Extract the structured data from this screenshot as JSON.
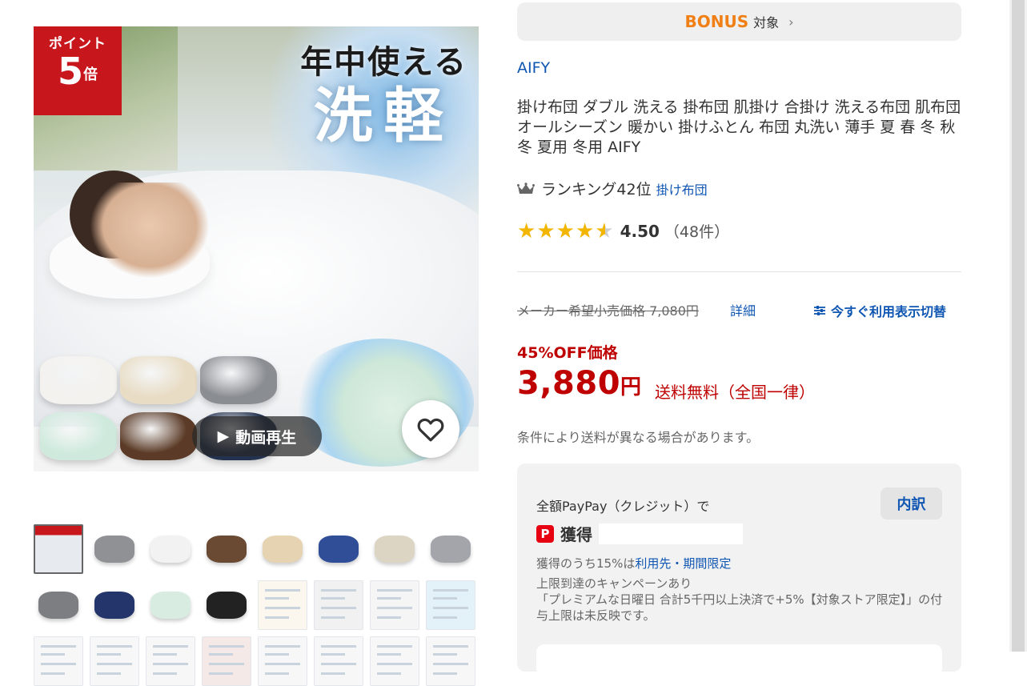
{
  "gallery": {
    "badge": {
      "line1": "ポイント",
      "number": "5",
      "suffix": "倍"
    },
    "headline": {
      "line1": "年中使える",
      "line2": "洗軽"
    },
    "video_label": "動画再生",
    "video_icon": "play-icon",
    "favorite_icon": "heart-icon",
    "swatch_colors": [
      "#f4f2ee",
      "#e8dcc4",
      "#8a8d92",
      "#cfeadd",
      "#5b3b27",
      "#23324f"
    ],
    "thumbnails_row1": [
      {
        "kind": "image",
        "color": "#e7ebef"
      },
      {
        "kind": "fold",
        "color": "#8f9194"
      },
      {
        "kind": "fold",
        "color": "#f2f2f2"
      },
      {
        "kind": "fold",
        "color": "#6b4a33"
      },
      {
        "kind": "fold",
        "color": "#e6d3b1"
      },
      {
        "kind": "fold",
        "color": "#2f4e97"
      },
      {
        "kind": "fold",
        "color": "#ddd5c4"
      },
      {
        "kind": "fold",
        "color": "#a3a5ab"
      }
    ],
    "thumbnails_row2": [
      {
        "kind": "fold",
        "color": "#7c7e82"
      },
      {
        "kind": "fold",
        "color": "#23356a"
      },
      {
        "kind": "fold",
        "color": "#d8ece1"
      },
      {
        "kind": "fold",
        "color": "#222222"
      },
      {
        "kind": "doc",
        "color": "#fbf7ee"
      },
      {
        "kind": "doc",
        "color": "#f1f1f1"
      },
      {
        "kind": "doc",
        "color": "#f5f5f5"
      },
      {
        "kind": "doc",
        "color": "#e3f1f8"
      }
    ],
    "thumbnails_row3": [
      {
        "kind": "doc",
        "color": "#f7f7f7"
      },
      {
        "kind": "doc",
        "color": "#f7f7f7"
      },
      {
        "kind": "doc",
        "color": "#f7f7f7"
      },
      {
        "kind": "doc",
        "color": "#f4e9e6"
      },
      {
        "kind": "doc",
        "color": "#f7f7f7"
      },
      {
        "kind": "doc",
        "color": "#f7f7f7"
      },
      {
        "kind": "doc",
        "color": "#f7f7f7"
      },
      {
        "kind": "doc",
        "color": "#f7f7f7"
      }
    ]
  },
  "bonus": {
    "logo": "BONUS",
    "label": "対象",
    "chevron": "chevron-right-icon"
  },
  "product": {
    "store": "AIFY",
    "title": "掛け布団 ダブル 洗える 掛布団 肌掛け 合掛け 洗える布団 肌布団 オールシーズン 暖かい 掛けふとん 布団 丸洗い 薄手 夏 春 冬 秋冬 夏用 冬用 AIFY",
    "ranking": {
      "text": "ランキング42位",
      "category": "掛け布団",
      "icon": "crown-icon"
    },
    "rating": {
      "value": 4.5,
      "score": "4.50",
      "count": "（48件）"
    }
  },
  "pricing": {
    "msrp": "メーカー希望小売価格 7,080円",
    "detail_link": "詳細",
    "switch_label": "今すぐ利用表示切替",
    "switch_icon": "sliders-icon",
    "discount": "45%OFF価格",
    "price": "3,880",
    "yen": "円",
    "shipping": "送料無料（全国一律）",
    "shipping_note": "条件により送料が異なる場合があります。",
    "accent_color": "#bf0000",
    "link_color": "#0f56b3"
  },
  "paypay": {
    "method": "全額PayPay（クレジット）で",
    "breakdown_button": "内訳",
    "earn_label": "獲得",
    "icon": "paypay-icon",
    "limit_prefix": "獲得のうち15%は",
    "limit_link": "利用先・期間限定",
    "campaign": "上限到達のキャンペーンあり",
    "campaign_detail": "「プレミアムな日曜日 合計5千円以上決済で+5%【対象ストア限定】」の付与上限は未反映です。"
  }
}
